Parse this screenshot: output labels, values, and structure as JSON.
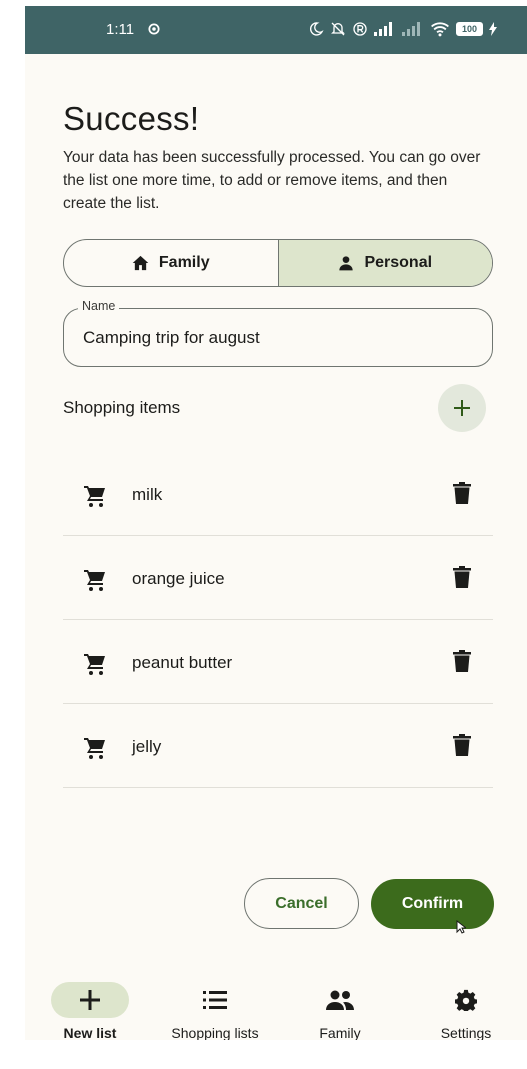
{
  "status_bar": {
    "time": "1:11",
    "battery": "100"
  },
  "header": {
    "title": "Success!",
    "subtitle": "Your data has been successfully processed. You can go over the list one more time, to add or remove items, and then create the list."
  },
  "segmented": {
    "options": [
      {
        "label": "Family",
        "icon": "home-icon",
        "selected": false
      },
      {
        "label": "Personal",
        "icon": "person-icon",
        "selected": true
      }
    ]
  },
  "name_field": {
    "label": "Name",
    "value": "Camping trip for august"
  },
  "shopping_items": {
    "header": "Shopping items",
    "items": [
      {
        "label": "milk"
      },
      {
        "label": "orange juice"
      },
      {
        "label": "peanut butter"
      },
      {
        "label": "jelly"
      }
    ]
  },
  "actions": {
    "cancel_label": "Cancel",
    "confirm_label": "Confirm"
  },
  "bottom_nav": {
    "items": [
      {
        "label": "New list",
        "icon": "plus-icon",
        "active": true
      },
      {
        "label": "Shopping lists",
        "icon": "list-icon",
        "active": false
      },
      {
        "label": "Family",
        "icon": "group-icon",
        "active": false
      },
      {
        "label": "Settings",
        "icon": "gear-icon",
        "active": false
      }
    ]
  },
  "colors": {
    "status_bar": "#3f6466",
    "background": "#fcfaf5",
    "selected_segment": "#dde5cc",
    "primary": "#3c6b1c",
    "cancel_text": "#3b6e2b"
  }
}
